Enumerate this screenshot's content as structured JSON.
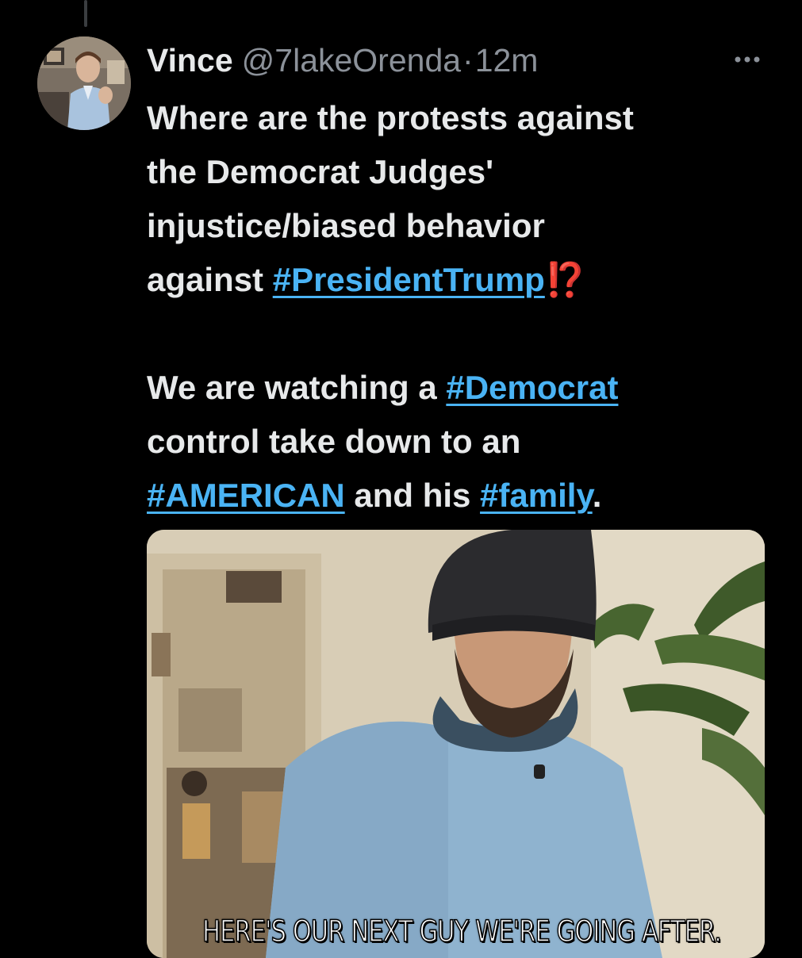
{
  "tweet": {
    "author": {
      "display_name": "Vince",
      "handle": "@7lakeOrenda",
      "separator": "·",
      "time_ago": "12m"
    },
    "more_icon": "more-horizontal-icon",
    "text": {
      "p1_line1": "Where are the protests against",
      "p1_line2": "the Democrat Judges'",
      "p1_line3": "injustice/biased behavior",
      "p1_line4_prefix": "against ",
      "hashtag_president_trump": "#PresidentTrump",
      "emoji": "⁉️",
      "p2_line1_prefix": "We are watching a ",
      "hashtag_democrat": "#Democrat",
      "p2_line2": "control take down to an",
      "hashtag_american": "#AMERICAN",
      "p2_line3_mid": " and his ",
      "hashtag_family": "#family",
      "p2_line3_suffix": "."
    },
    "media": {
      "caption": "HERE'S OUR NEXT GUY WE'RE GOING AFTER."
    }
  },
  "colors": {
    "background": "#000000",
    "text_primary": "#e7e9ea",
    "text_secondary": "#8b9199",
    "link": "#4ab3f4",
    "emoji_red": "#f4212e"
  }
}
